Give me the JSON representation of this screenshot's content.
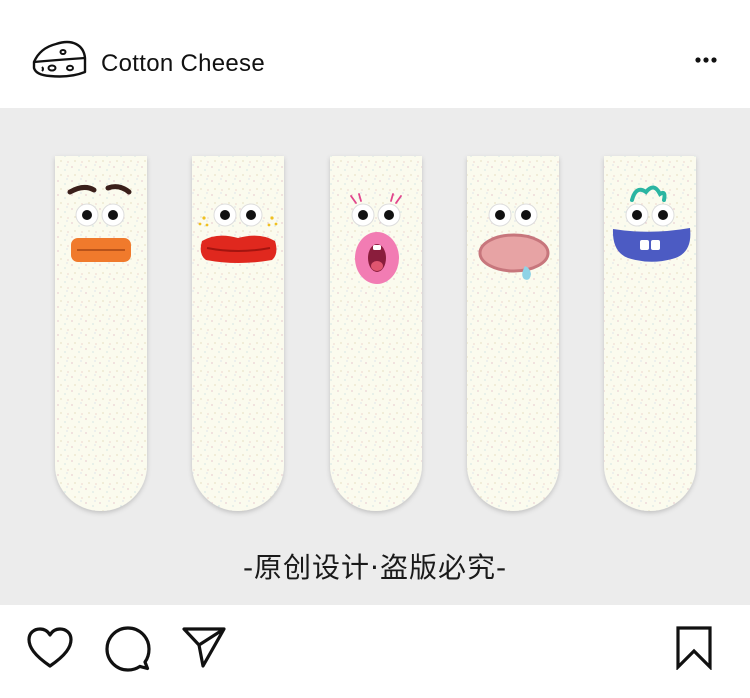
{
  "header": {
    "account_name": "Cotton Cheese",
    "logo_icon": "cheese-logo-icon",
    "more_icon": "more-options-icon"
  },
  "post": {
    "caption": "-原创设计·盗版必究-",
    "socks": [
      {
        "face": "flat-orange-lips"
      },
      {
        "face": "big-red-lips"
      },
      {
        "face": "pink-surprised-mouth"
      },
      {
        "face": "drooling-pink-mouth"
      },
      {
        "face": "blue-toothy-grin"
      }
    ]
  },
  "actions": {
    "like_icon": "heart-icon",
    "comment_icon": "comment-icon",
    "share_icon": "send-icon",
    "save_icon": "bookmark-icon"
  },
  "colors": {
    "sock": "#fbfbee",
    "background": "#ececec",
    "orange_lips": "#f07a2c",
    "red_lips": "#e0281e",
    "pink_mouth": "#f27cb3",
    "tongue_pink": "#e7a3a4",
    "blue_mouth": "#4c5bc3",
    "teal_hair": "#2ab5a2"
  }
}
